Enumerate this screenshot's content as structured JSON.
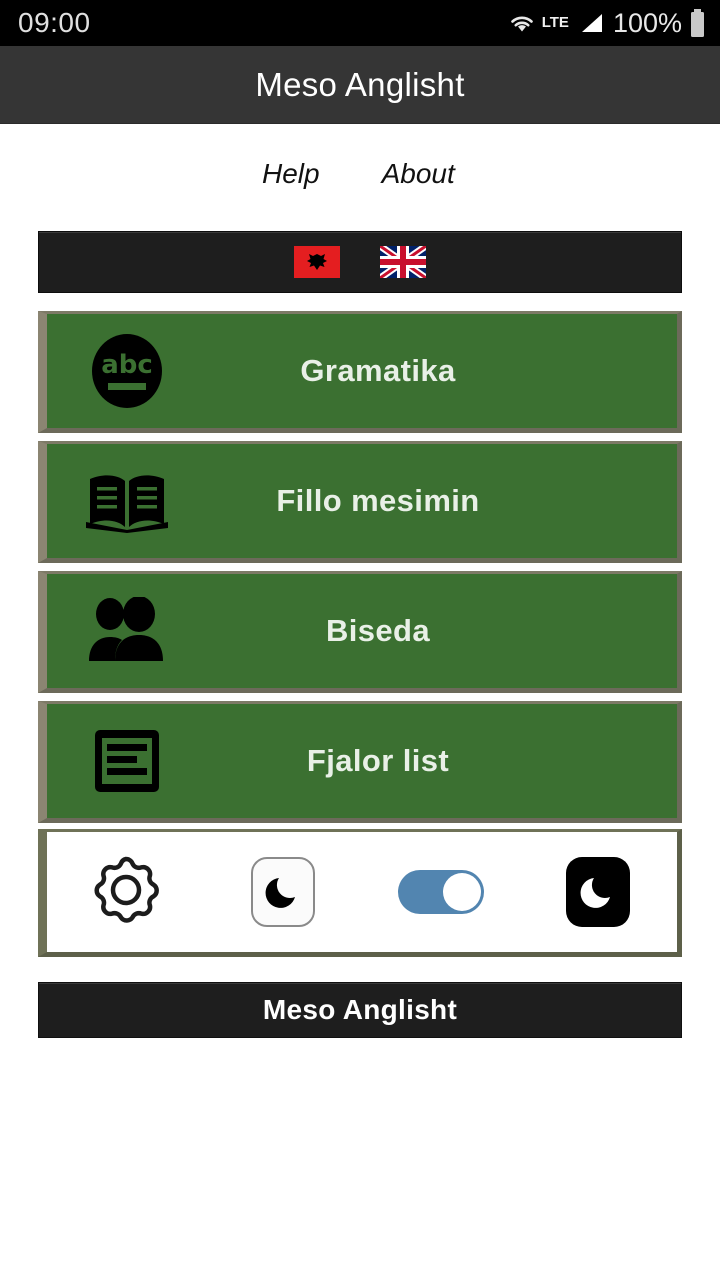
{
  "status_bar": {
    "time": "09:00",
    "network_label": "LTE",
    "battery_percent": "100%",
    "wifi_icon": "wifi-icon",
    "signal_icon": "signal-bars-icon",
    "battery_icon": "battery-full-icon"
  },
  "app_bar": {
    "title": "Meso Anglisht"
  },
  "links": [
    {
      "label": "Help",
      "name": "help-link"
    },
    {
      "label": "About",
      "name": "about-link"
    }
  ],
  "language_bar": {
    "flags": [
      {
        "name": "albanian-flag",
        "label": "Albanian",
        "eagle": "☲"
      },
      {
        "name": "uk-flag",
        "label": "English"
      }
    ]
  },
  "menu_buttons": [
    {
      "label": "Gramatika",
      "icon": "abc-icon",
      "icon_text": "abc"
    },
    {
      "label": "Fillo mesimin",
      "icon": "open-book-icon"
    },
    {
      "label": "Biseda",
      "icon": "people-icon"
    },
    {
      "label": "Fjalor list",
      "icon": "list-document-icon"
    }
  ],
  "settings_panel": {
    "gear_icon": "gear-icon",
    "light_mode_icon": "moon-light-icon",
    "theme_toggle": {
      "name": "theme-toggle",
      "state": "on"
    },
    "dark_mode_icon": "moon-dark-icon"
  },
  "bottom_banner": {
    "label": "Meso Anglisht"
  },
  "colors": {
    "button_green": "#3b7031",
    "button_border": "#8b8572",
    "app_bar": "#353535",
    "status_bar": "#000000",
    "banner_dark": "#1e1e1e",
    "toggle_on": "#5285b0",
    "label_text": "#e9f0e7"
  }
}
